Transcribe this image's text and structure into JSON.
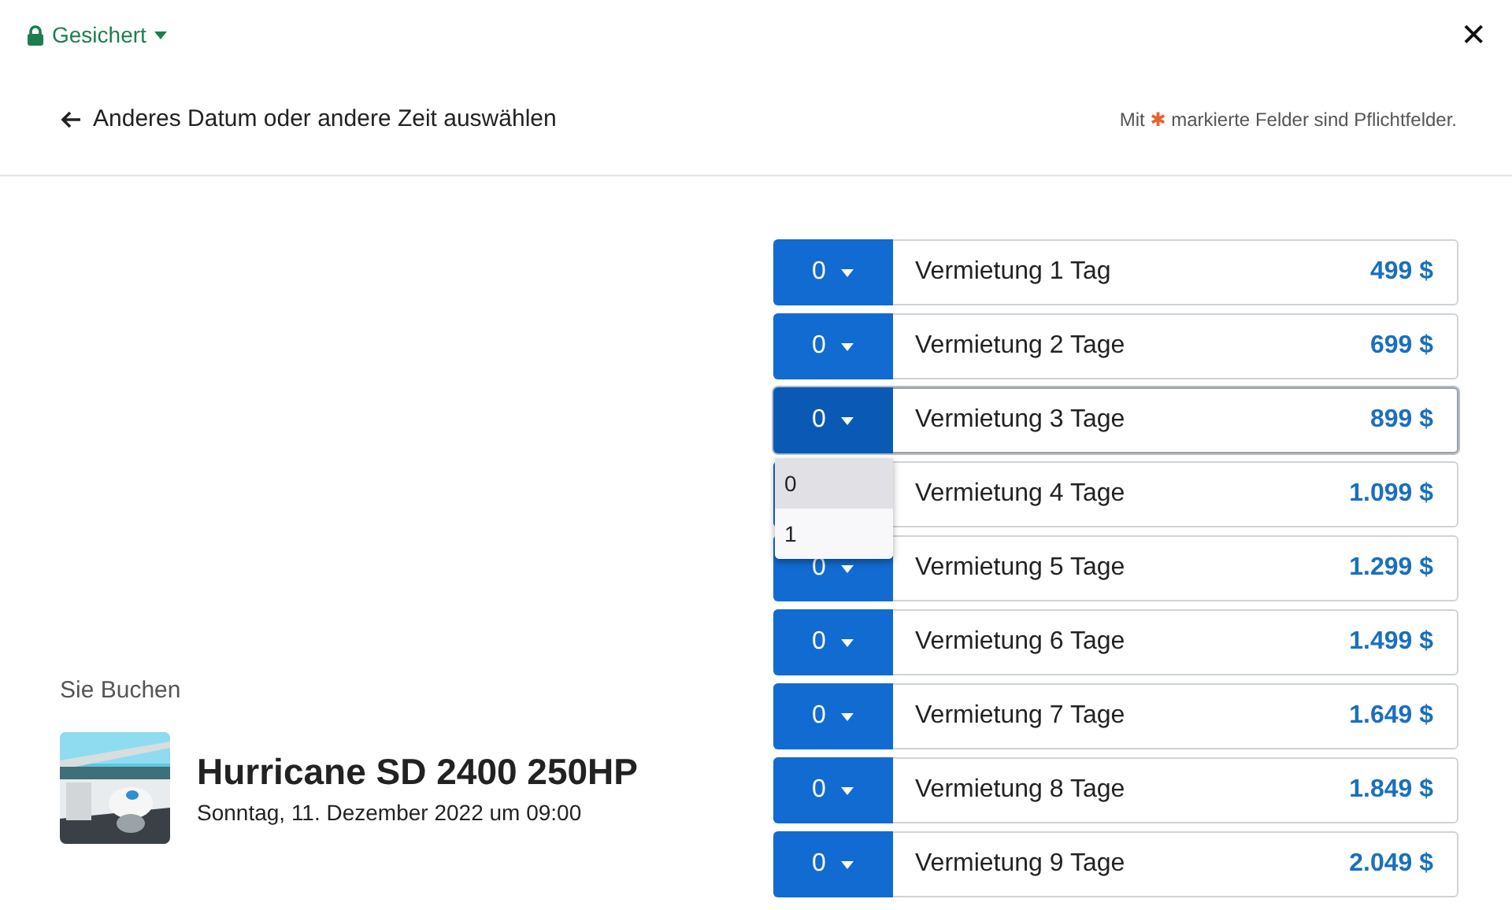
{
  "security": {
    "label": "Gesichert"
  },
  "close": {
    "label": "✕"
  },
  "back_link": {
    "label": "Anderes Datum oder andere Zeit auswählen"
  },
  "required_note": {
    "before": "Mit",
    "mark": "✱",
    "after": "markierte Felder sind Pflichtfelder."
  },
  "booking": {
    "heading": "Sie Buchen",
    "title": "Hurricane SD 2400 250HP",
    "date": "Sonntag, 11. Dezember 2022 um 09:00"
  },
  "rates": [
    {
      "quantity": "0",
      "label": "Vermietung 1 Tag",
      "price": "499 $",
      "focused": false
    },
    {
      "quantity": "0",
      "label": "Vermietung 2 Tage",
      "price": "699 $",
      "focused": false
    },
    {
      "quantity": "0",
      "label": "Vermietung 3 Tage",
      "price": "899 $",
      "focused": true,
      "options": [
        {
          "label": "0",
          "selected": true
        },
        {
          "label": "1",
          "selected": false
        }
      ]
    },
    {
      "label": "Vermietung 4 Tage",
      "price": "1.099 $",
      "focused": false
    },
    {
      "quantity": "0",
      "label": "Vermietung 5 Tage",
      "price": "1.299 $",
      "focused": false
    },
    {
      "quantity": "0",
      "label": "Vermietung 6 Tage",
      "price": "1.499 $",
      "focused": false
    },
    {
      "quantity": "0",
      "label": "Vermietung 7 Tage",
      "price": "1.649 $",
      "focused": false
    },
    {
      "quantity": "0",
      "label": "Vermietung 8 Tage",
      "price": "1.849 $",
      "focused": false
    },
    {
      "quantity": "0",
      "label": "Vermietung 9 Tage",
      "price": "2.049 $",
      "focused": false
    }
  ]
}
